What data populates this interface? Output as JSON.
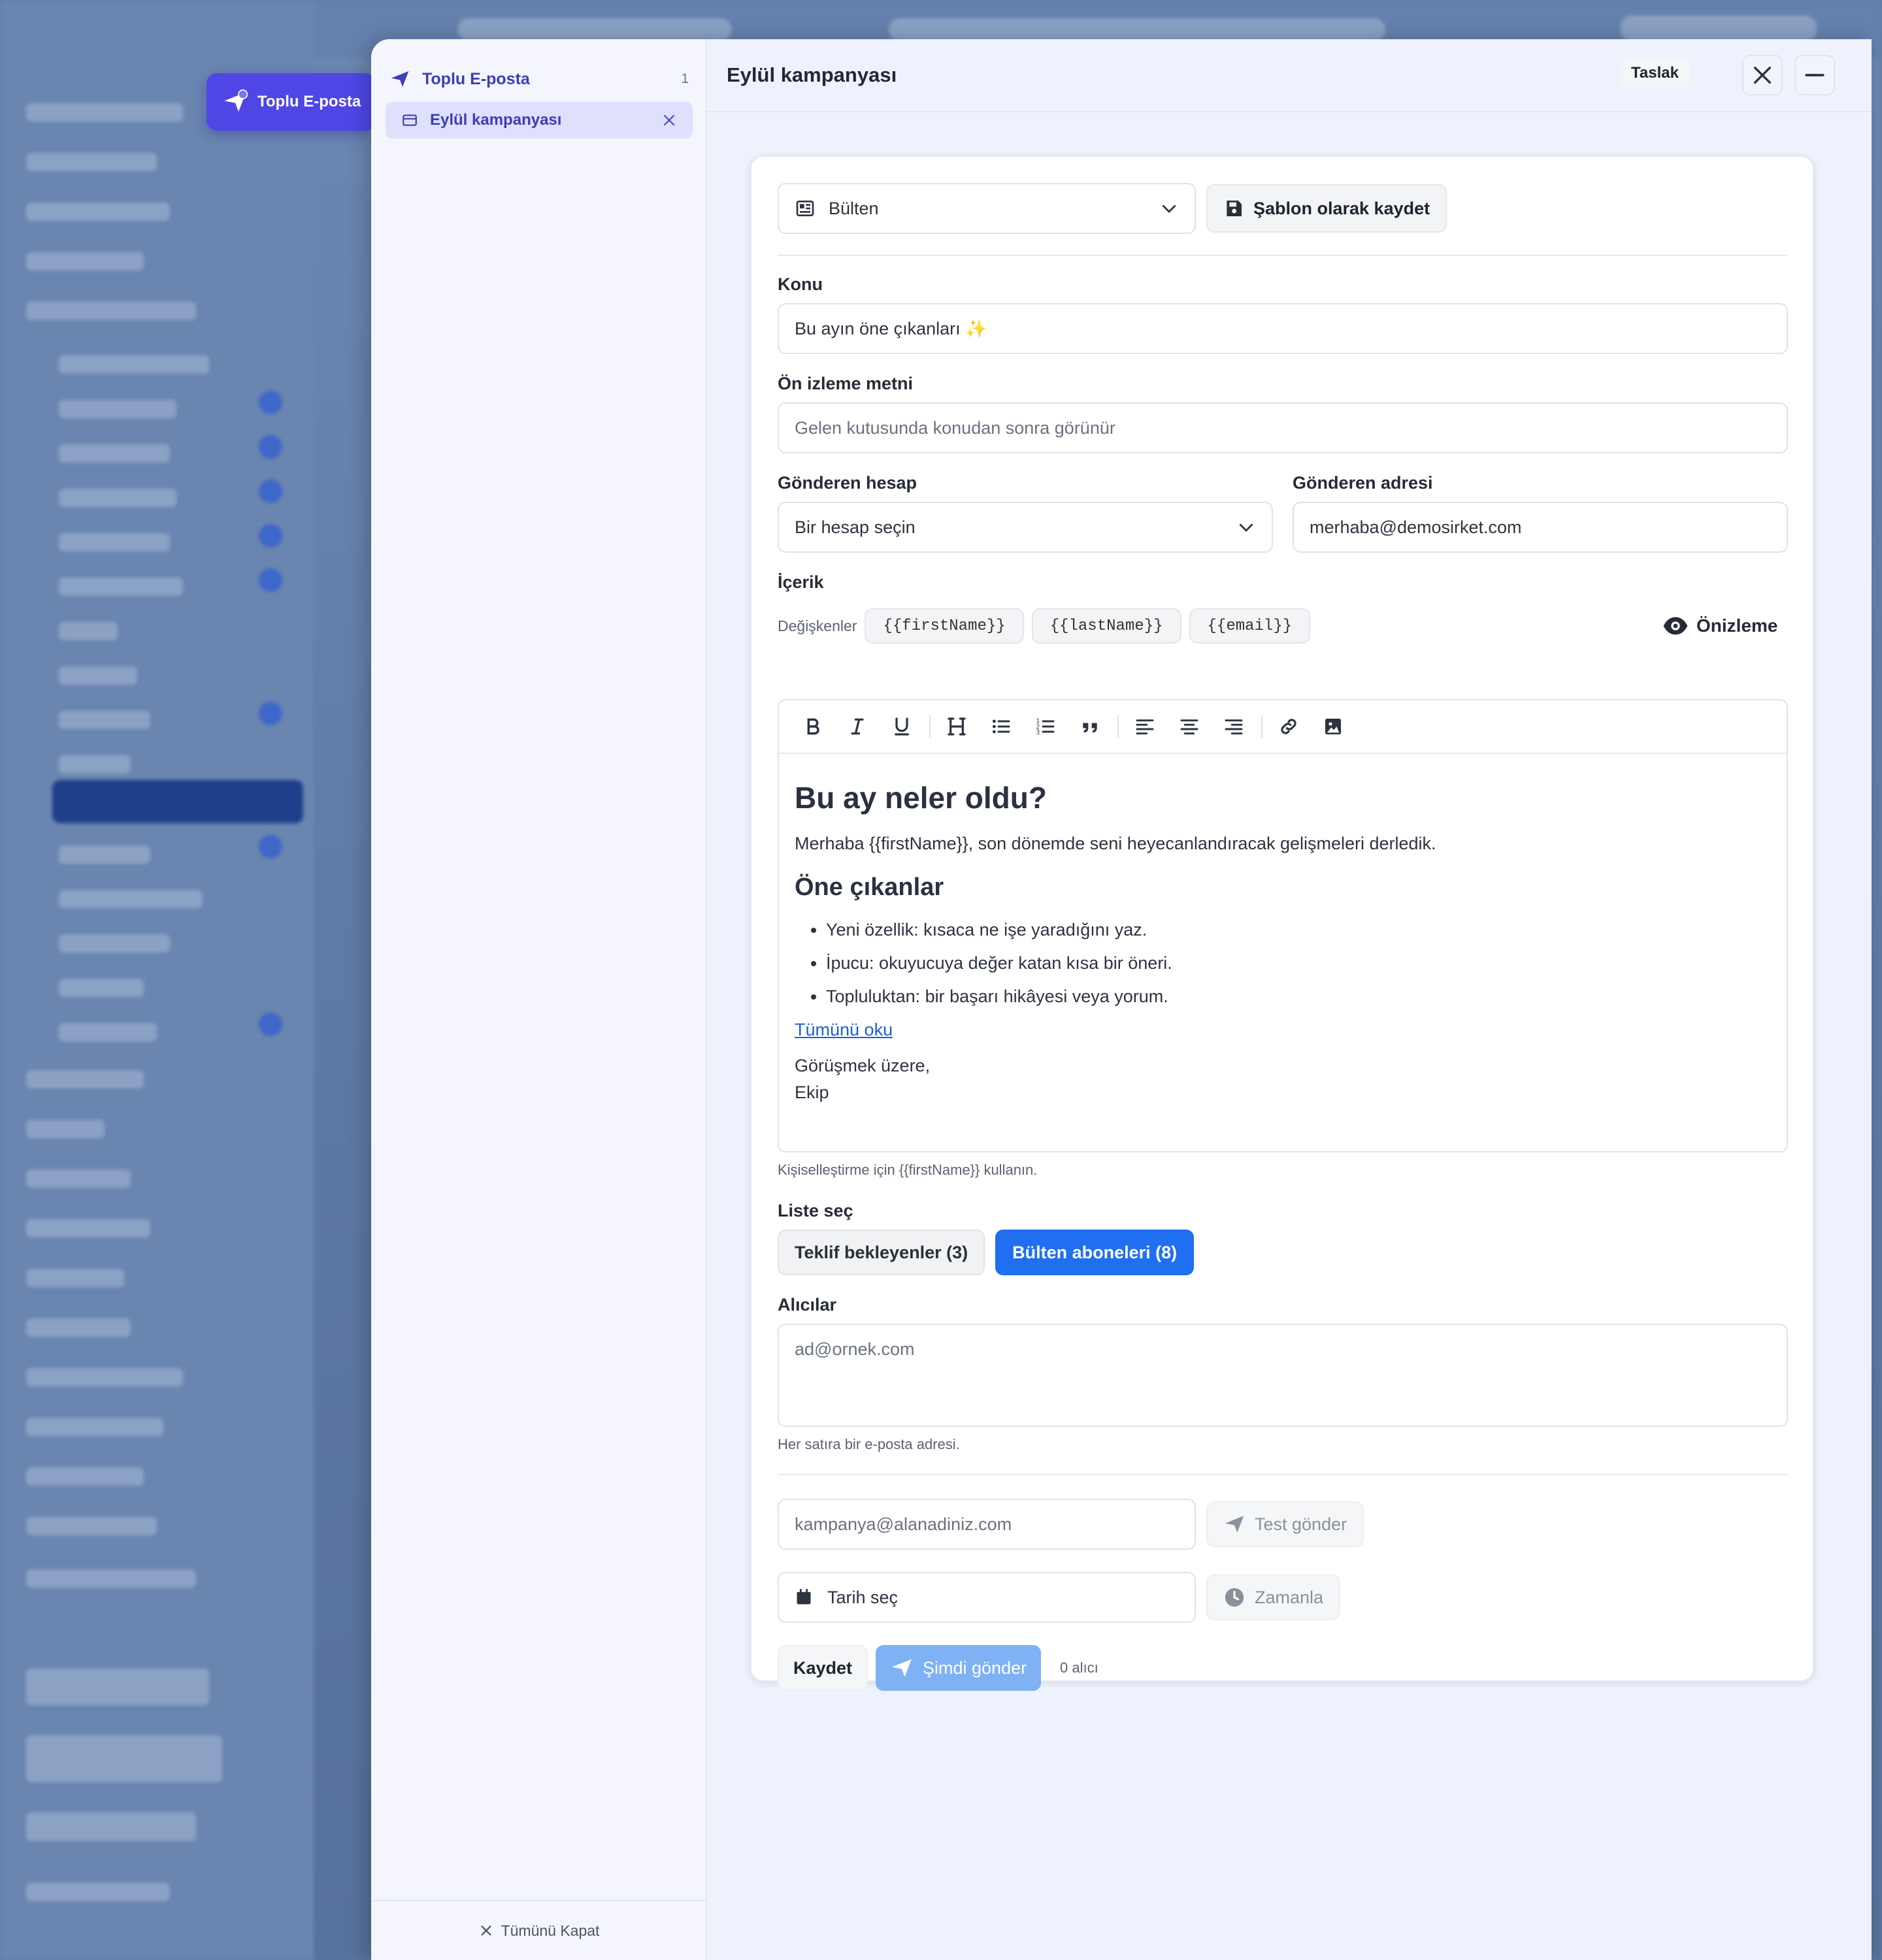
{
  "fab": {
    "label": "Toplu E-posta"
  },
  "sidebar": {
    "section_title": "Toplu E-posta",
    "count": "1",
    "item_label": "Eylül kampanyası",
    "close_all": "Tümünü Kapat"
  },
  "header": {
    "title": "Eylül kampanyası",
    "status_badge": "Taslak"
  },
  "template": {
    "selected": "Bülten",
    "save_button": "Şablon olarak kaydet"
  },
  "subject": {
    "label": "Konu",
    "value": "Bu ayın öne çıkanları ✨"
  },
  "preview_text": {
    "label": "Ön izleme metni",
    "placeholder": "Gelen kutusunda konudan sonra görünür"
  },
  "sender_account": {
    "label": "Gönderen hesap",
    "placeholder": "Bir hesap seçin"
  },
  "sender_address": {
    "label": "Gönderen adresi",
    "value": "merhaba@demosirket.com"
  },
  "content": {
    "label": "İçerik",
    "variables_label": "Değişkenler",
    "variables": [
      "{{firstName}}",
      "{{lastName}}",
      "{{email}}"
    ],
    "preview_button": "Önizleme",
    "heading": "Bu ay neler oldu?",
    "intro": "Merhaba {{firstName}}, son dönemde seni heyecanlandıracak gelişmeleri derledik.",
    "subheading": "Öne çıkanlar",
    "bullets": [
      "Yeni özellik: kısaca ne işe yaradığını yaz.",
      "İpucu: okuyucuya değer katan kısa bir öneri.",
      "Topluluktan: bir başarı hikâyesi veya yorum."
    ],
    "link_text": "Tümünü oku",
    "closing": "Görüşmek üzere,",
    "signature": "Ekip",
    "hint": "Kişiselleştirme için {{firstName}} kullanın."
  },
  "lists": {
    "label": "Liste seç",
    "items": [
      {
        "label": "Teklif bekleyenler (3)",
        "selected": false
      },
      {
        "label": "Bülten aboneleri (8)",
        "selected": true
      }
    ]
  },
  "recipients": {
    "label": "Alıcılar",
    "placeholder": "ad@ornek.com",
    "hint": "Her satıra bir e-posta adresi."
  },
  "test": {
    "placeholder": "kampanya@alanadiniz.com",
    "button": "Test gönder"
  },
  "schedule": {
    "placeholder": "Tarih seç",
    "button": "Zamanla"
  },
  "actions": {
    "save": "Kaydet",
    "send_now": "Şimdi gönder",
    "recipient_count": "0 alıcı"
  },
  "colors": {
    "accent": "#4f46e5",
    "primary_blue": "#1f6ff0",
    "send_disabled": "#7fb1f5",
    "panel_bg": "#eef2fc"
  }
}
